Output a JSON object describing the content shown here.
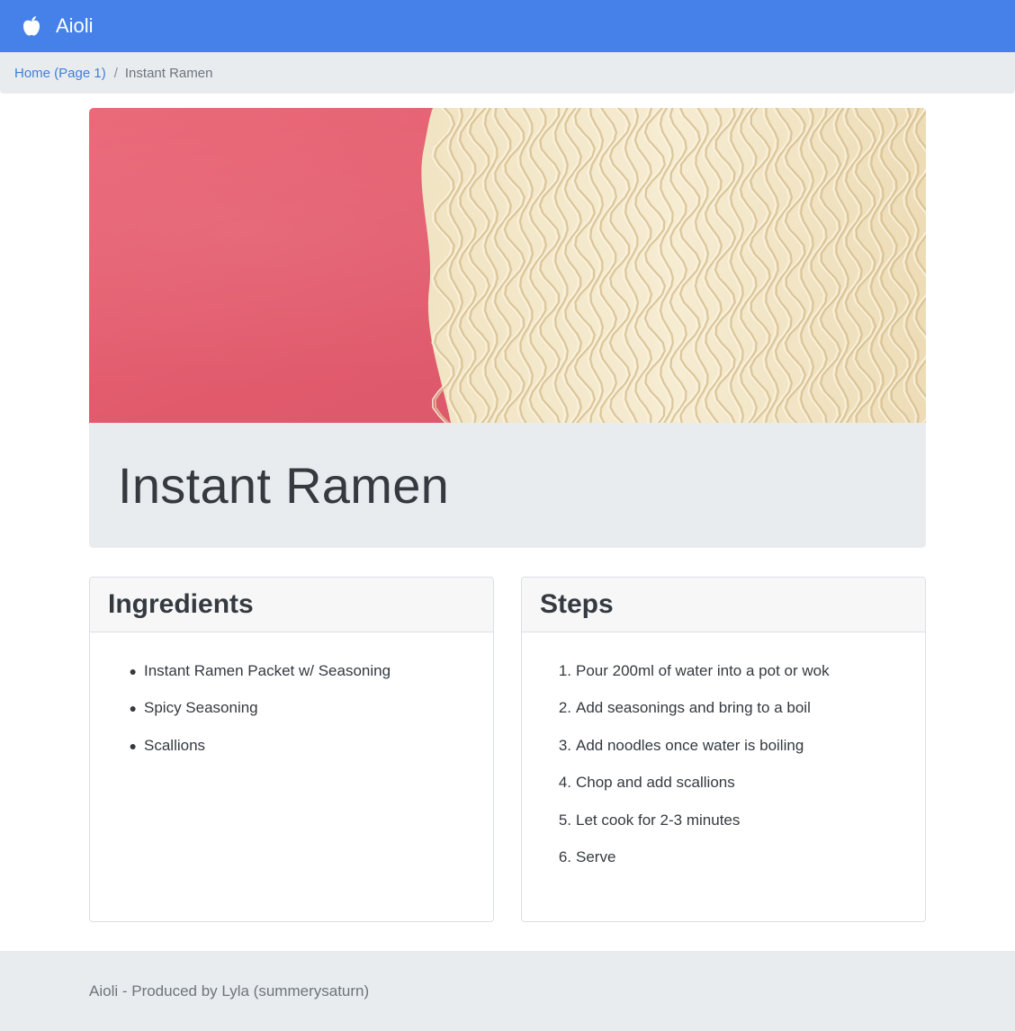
{
  "navbar": {
    "brand": "Aioli",
    "icon": "apple-icon"
  },
  "breadcrumb": {
    "home": "Home (Page 1)",
    "separator": "/",
    "current": "Instant Ramen"
  },
  "recipe": {
    "title": "Instant Ramen",
    "image": "instant-ramen-noodles-photo"
  },
  "ingredients": {
    "title": "Ingredients",
    "items": [
      "Instant Ramen Packet w/ Seasoning",
      "Spicy Seasoning",
      "Scallions"
    ]
  },
  "steps": {
    "title": "Steps",
    "items": [
      {
        "n": "1.",
        "text": "Pour 200ml of water into a pot or wok"
      },
      {
        "n": "2.",
        "text": "Add seasonings and bring to a boil"
      },
      {
        "n": "3.",
        "text": "Add noodles once water is boiling"
      },
      {
        "n": "4.",
        "text": "Chop and add scallions"
      },
      {
        "n": "5.",
        "text": "Let cook for 2-3 minutes"
      },
      {
        "n": "6.",
        "text": "Serve"
      }
    ]
  },
  "footer": {
    "text": "Aioli - Produced by Lyla (summerysaturn)"
  },
  "colors": {
    "navbar": "#4581e8",
    "link": "#3f7fd9",
    "panel": "#e9ecef",
    "hero_bg": "#e05a6c"
  }
}
